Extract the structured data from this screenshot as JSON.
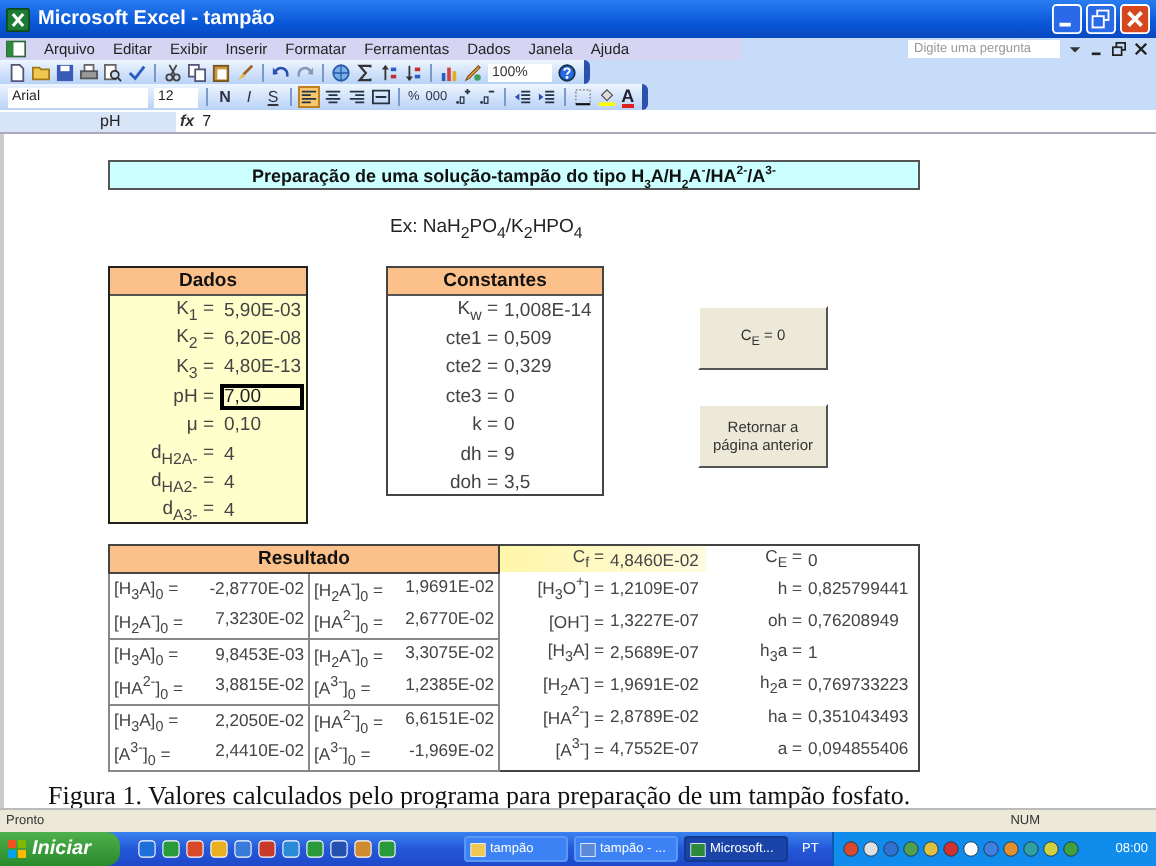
{
  "window": {
    "title": "Microsoft Excel - tampão"
  },
  "menu": [
    "Arquivo",
    "Editar",
    "Exibir",
    "Inserir",
    "Formatar",
    "Ferramentas",
    "Dados",
    "Janela",
    "Ajuda"
  ],
  "help_search": {
    "placeholder": "Digite uma pergunta"
  },
  "toolbar": {
    "zoom": "100%",
    "font": "Arial",
    "font_size": "12",
    "style_buttons": [
      {
        "label": "N",
        "kind": "bold",
        "selected": false
      },
      {
        "label": "I",
        "kind": "italic",
        "selected": false
      },
      {
        "label": "S",
        "kind": "underline",
        "selected": false
      }
    ],
    "alignment": [
      {
        "selected": true
      },
      {
        "selected": false
      },
      {
        "selected": false
      },
      {
        "selected": false
      }
    ],
    "number_buttons": [
      "%",
      "000"
    ],
    "font_color": "A"
  },
  "formula_bar": {
    "name_box": "pH",
    "fx": "fx",
    "value": "7"
  },
  "sheet": {
    "title": "Preparação de uma solução-tampão do tipo H$_{3}$A/H$_{2}$A$^{-}$/HA$^{2-}$/A$^{3-}$",
    "example": "Ex: NaH$_{2}$PO$_{4}$/K$_{2}$HPO$_{4}$",
    "dados": {
      "header": "Dados",
      "rows": [
        {
          "label": "K$_{1}$ =",
          "value": "5,90E-03",
          "selected": false
        },
        {
          "label": "K$_{2}$ =",
          "value": "6,20E-08",
          "selected": false
        },
        {
          "label": "K$_{3}$ =",
          "value": "4,80E-13",
          "selected": false
        },
        {
          "label": "pH =",
          "value": "7,00",
          "selected": true
        },
        {
          "label": "μ =",
          "value": "0,10",
          "selected": false
        },
        {
          "label": "d$_{H2A-}$ =",
          "value": "4",
          "selected": false
        },
        {
          "label": "d$_{HA2-}$ =",
          "value": "4",
          "selected": false
        },
        {
          "label": "d$_{A3-}$ =",
          "value": "4",
          "selected": false
        }
      ]
    },
    "constantes": {
      "header": "Constantes",
      "rows": [
        {
          "label": "K$_{w}$ =",
          "value": "1,008E-14"
        },
        {
          "label": "cte1 =",
          "value": "0,509"
        },
        {
          "label": "cte2 =",
          "value": "0,329"
        },
        {
          "label": "cte3 =",
          "value": "0"
        },
        {
          "label": "k =",
          "value": "0"
        },
        {
          "label": "dh =",
          "value": "9"
        },
        {
          "label": "doh =",
          "value": "3,5"
        }
      ]
    },
    "buttons": [
      "C$_{E}$ = 0",
      "Retornar a página anterior"
    ],
    "resultado": {
      "header": "Resultado",
      "rows": [
        [
          {
            "label": "[H$_{3}$A]$_{0}$ =",
            "value": "-2,8770E-02"
          },
          {
            "label": "[H$_{2}$A$^{-}$]$_{0}$ =",
            "value": "1,9691E-02"
          }
        ],
        [
          {
            "label": "[H$_{2}$A$^{-}$]$_{0}$ =",
            "value": "7,3230E-02"
          },
          {
            "label": "[HA$^{2-}$]$_{0}$ =",
            "value": "2,6770E-02"
          }
        ],
        [
          {
            "label": "[H$_{3}$A]$_{0}$ =",
            "value": "9,8453E-03"
          },
          {
            "label": "[H$_{2}$A$^{-}$]$_{0}$ =",
            "value": "3,3075E-02"
          }
        ],
        [
          {
            "label": "[HA$^{2-}$]$_{0}$ =",
            "value": "3,8815E-02"
          },
          {
            "label": "[A$^{3-}$]$_{0}$ =",
            "value": "1,2385E-02"
          }
        ],
        [
          {
            "label": "[H$_{3}$A]$_{0}$ =",
            "value": "2,2050E-02"
          },
          {
            "label": "[HA$^{2-}$]$_{0}$ =",
            "value": "6,6151E-02"
          }
        ],
        [
          {
            "label": "[A$^{3-}$]$_{0}$ =",
            "value": "2,4410E-02"
          },
          {
            "label": "[A$^{3-}$]$_{0}$ =",
            "value": "-1,969E-02"
          }
        ]
      ],
      "summary": [
        [
          {
            "label": "C$_{f}$ =",
            "value": "4,8460E-02",
            "highlighted": true
          },
          {
            "label": "C$_{E}$ =",
            "value": "0",
            "highlighted": false
          }
        ],
        [
          {
            "label": "[H$_{3}$O$^{+}$] =",
            "value": "1,2109E-07",
            "highlighted": false
          },
          {
            "label": "h =",
            "value": "0,825799441",
            "highlighted": false
          }
        ],
        [
          {
            "label": "[OH$^{-}$] =",
            "value": "1,3227E-07",
            "highlighted": false
          },
          {
            "label": "oh =",
            "value": "0,76208949",
            "highlighted": false
          }
        ],
        [
          {
            "label": "[H$_{3}$A] =",
            "value": "2,5689E-07",
            "highlighted": false
          },
          {
            "label": "h$_{3}$a =",
            "value": "1",
            "highlighted": false
          }
        ],
        [
          {
            "label": "[H$_{2}$A$^{-}$] =",
            "value": "1,9691E-02",
            "highlighted": false
          },
          {
            "label": "h$_{2}$a =",
            "value": "0,769733223",
            "highlighted": false
          }
        ],
        [
          {
            "label": "[HA$^{2-}$] =",
            "value": "2,8789E-02",
            "highlighted": false
          },
          {
            "label": "ha =",
            "value": "0,351043493",
            "highlighted": false
          }
        ],
        [
          {
            "label": "[A$^{3-}$] =",
            "value": "4,7552E-07",
            "highlighted": false
          },
          {
            "label": "a =",
            "value": "0,094855406",
            "highlighted": false
          }
        ]
      ]
    }
  },
  "caption": "Figura 1. Valores calculados pelo programa para preparação de um tampão fosfato.",
  "status_bar": {
    "left": "Pronto",
    "right": "NUM"
  },
  "taskbar": {
    "start": "Iniciar",
    "tasks": [
      {
        "label": "tampão",
        "kind": "folder",
        "selected": false
      },
      {
        "label": "tampão - ...",
        "kind": "document",
        "selected": false
      },
      {
        "label": "Microsoft...",
        "kind": "spreadsheet",
        "selected": true
      }
    ],
    "language": "PT",
    "clock": "08:00"
  }
}
